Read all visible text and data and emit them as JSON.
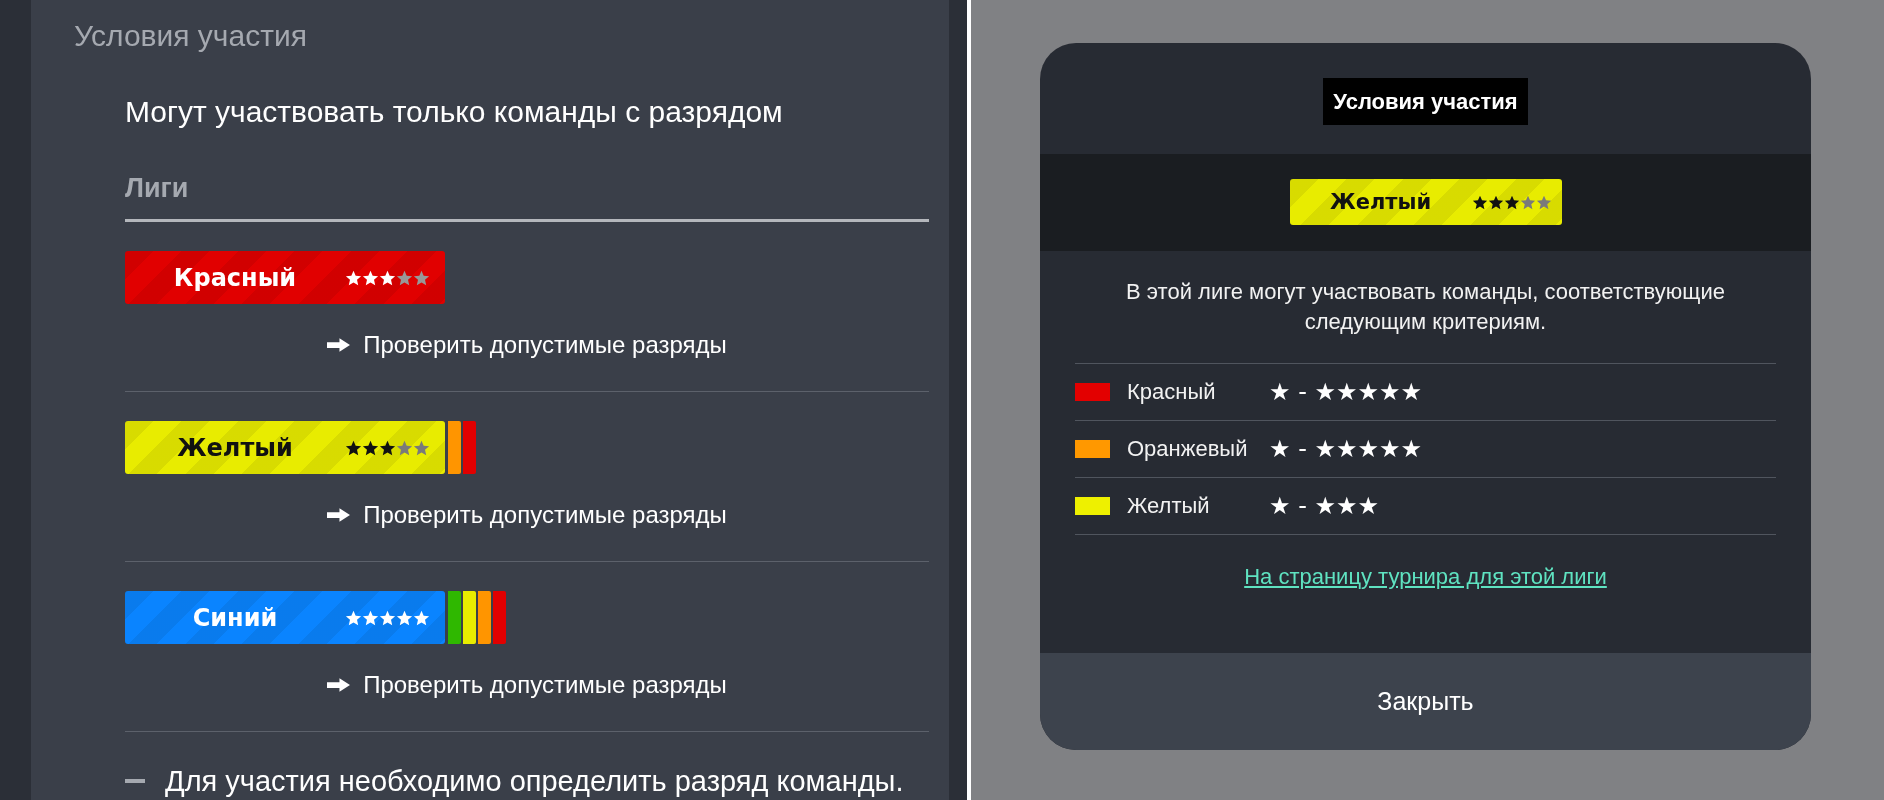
{
  "panel": {
    "title": "Условия участия",
    "intro": "Могут участвовать только команды с разрядом",
    "leagues_heading": "Лиги",
    "leagues": [
      {
        "name": "Красный",
        "color": "#e10000",
        "stars": 3,
        "link": "Проверить допустимые разряды"
      },
      {
        "name": "Желтый",
        "color": "#e8ec00",
        "stars": 3,
        "lower_leagues": [
          {
            "color": "#ff9500"
          },
          {
            "color": "#e10000"
          }
        ],
        "link": "Проверить допустимые разряды"
      },
      {
        "name": "Синий",
        "color": "#0a84ff",
        "stars": 5,
        "lower_leagues": [
          {
            "color": "#2fb800"
          },
          {
            "color": "#e8ec00"
          },
          {
            "color": "#ff9500"
          },
          {
            "color": "#e10000"
          }
        ],
        "link": "Проверить допустимые разряды"
      }
    ],
    "note": "Для участия необходимо определить разряд команды."
  },
  "modal": {
    "title": "Условия участия",
    "league": {
      "name": "Желтый",
      "color": "#e8ec00",
      "stars": 3
    },
    "description": "В этой лиге могут участвовать команды, соответствующие следующим критериям.",
    "criteria": [
      {
        "name": "Красный",
        "color": "#e30000",
        "range": "★ - ★★★★★"
      },
      {
        "name": "Оранжевый",
        "color": "#ff9800",
        "range": "★ - ★★★★★"
      },
      {
        "name": "Желтый",
        "color": "#eef000",
        "range": "★ - ★★★"
      }
    ],
    "link": "На страницу турнира для этой лиги",
    "close_button": "Закрыть"
  }
}
